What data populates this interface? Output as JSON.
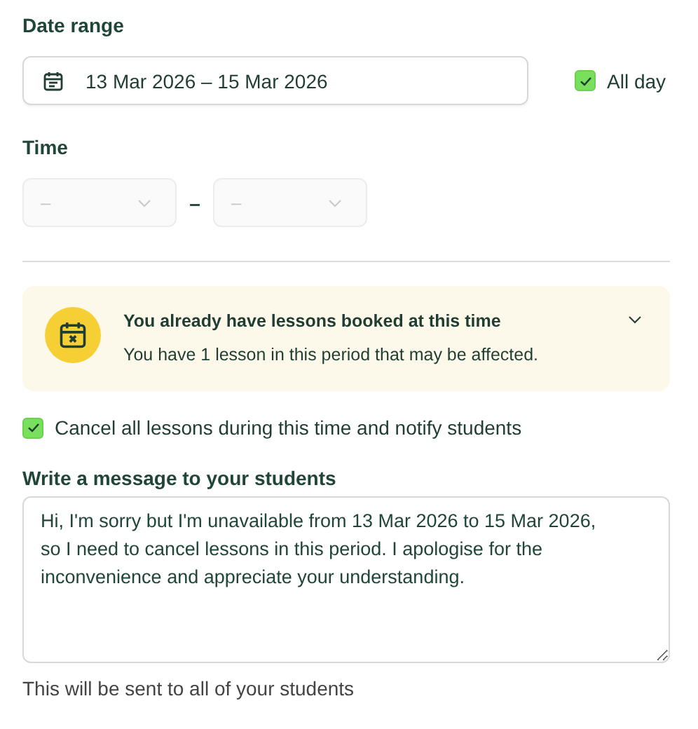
{
  "date_range": {
    "label": "Date range",
    "value": "13 Mar 2026 – 15 Mar 2026"
  },
  "all_day": {
    "label": "All day",
    "checked": true
  },
  "time": {
    "label": "Time",
    "separator": "–",
    "fields": [
      {
        "placeholder": "–",
        "disabled": true
      },
      {
        "placeholder": "–",
        "disabled": true
      }
    ]
  },
  "alert": {
    "title": "You already have lessons booked at this time",
    "text": "You have 1 lesson in this period that may be affected.",
    "expanded": false
  },
  "cancel_option": {
    "label": "Cancel all lessons during this time and notify students",
    "checked": true
  },
  "message": {
    "label": "Write a message to your students",
    "value": "Hi, I'm sorry but I'm unavailable from 13 Mar 2026 to 15 Mar 2026, so I need to cancel lessons in this period. I apologise for the inconvenience and appreciate your understanding.",
    "hint": "This will be sent to all of your students"
  }
}
